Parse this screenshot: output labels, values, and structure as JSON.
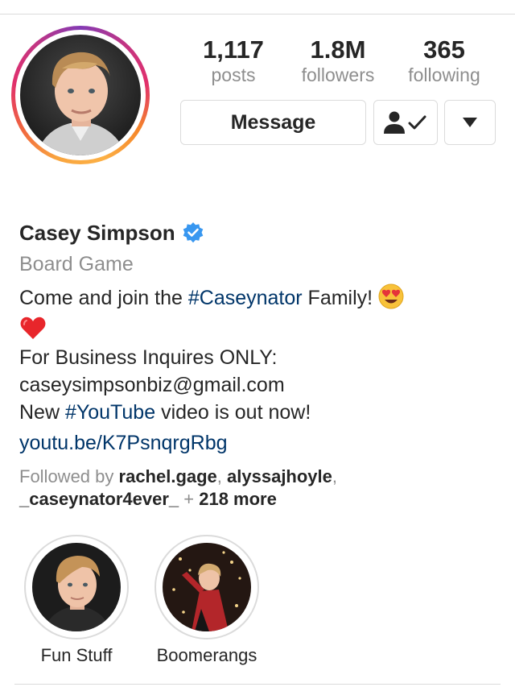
{
  "profile": {
    "name": "Casey Simpson",
    "verified": true,
    "category": "Board Game"
  },
  "stats": {
    "posts_count": "1,117",
    "posts_label": "posts",
    "followers_count": "1.8M",
    "followers_label": "followers",
    "following_count": "365",
    "following_label": "following"
  },
  "actions": {
    "message_label": "Message",
    "following_icon": "person-check-icon",
    "more_icon": "triangle-down-icon"
  },
  "bio": {
    "line1_prefix": "Come and join the ",
    "line1_hashtag": "#Caseynator",
    "line1_suffix": " Family!",
    "line1_emoji": "heart-eyes-emoji",
    "line2_emoji": "red-heart-emoji",
    "line3": "For Business Inquires ONLY:",
    "line4": "caseysimpsonbiz@gmail.com",
    "line5_prefix": "New ",
    "line5_hashtag": "#YouTube",
    "line5_suffix": " video is out now!",
    "link": "youtu.be/K7PsnqrgRbg"
  },
  "followed_by": {
    "prefix": "Followed by ",
    "user1": "rachel.gage",
    "sep1": ", ",
    "user2": "alyssajhoyle",
    "sep2": ",",
    "user3": "_caseynator4ever_",
    "plus": " + ",
    "more": "218 more"
  },
  "highlights": [
    {
      "label": "Fun Stuff"
    },
    {
      "label": "Boomerangs"
    }
  ],
  "colors": {
    "accent_link": "#003569",
    "secondary_text": "#8e8e8e",
    "verified_blue": "#3897f0",
    "border": "#dbdbdb"
  }
}
